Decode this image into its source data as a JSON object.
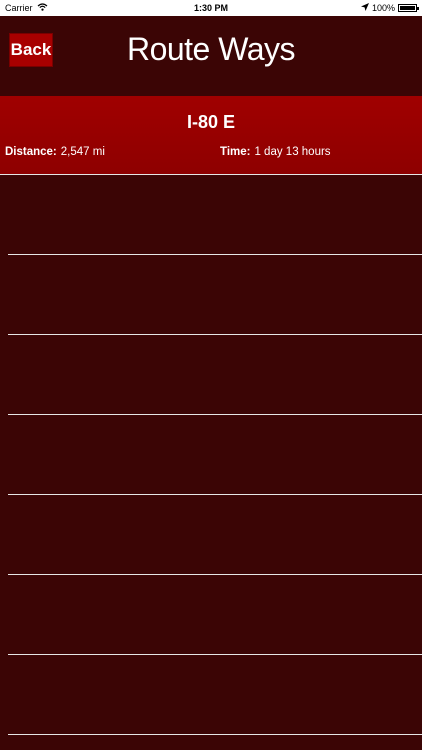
{
  "status_bar": {
    "carrier": "Carrier",
    "wifi_icon": "wifi-icon",
    "time": "1:30 PM",
    "location_icon": "location-arrow-icon",
    "battery": "100%",
    "battery_level": 1.0
  },
  "nav": {
    "back_label": "Back",
    "title": "Route Ways"
  },
  "route": {
    "name": "I-80 E",
    "distance_label": "Distance:",
    "distance_value": "2,547 mi",
    "time_label": "Time:",
    "time_value": "1 day 13 hours"
  },
  "list": {
    "rows": [
      "",
      "",
      "",
      "",
      "",
      "",
      ""
    ]
  },
  "colors": {
    "background": "#3b0505",
    "header": "#9a0000",
    "button": "#a80000"
  }
}
